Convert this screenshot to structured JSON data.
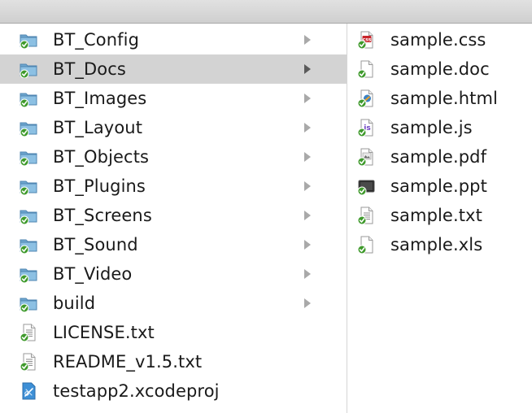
{
  "column1": {
    "items": [
      {
        "label": "BT_Config",
        "icon": "folder-icon",
        "kind": "folder",
        "selected": false
      },
      {
        "label": "BT_Docs",
        "icon": "folder-icon",
        "kind": "folder",
        "selected": true
      },
      {
        "label": "BT_Images",
        "icon": "folder-icon",
        "kind": "folder",
        "selected": false
      },
      {
        "label": "BT_Layout",
        "icon": "folder-icon",
        "kind": "folder",
        "selected": false
      },
      {
        "label": "BT_Objects",
        "icon": "folder-icon",
        "kind": "folder",
        "selected": false
      },
      {
        "label": "BT_Plugins",
        "icon": "folder-icon",
        "kind": "folder",
        "selected": false
      },
      {
        "label": "BT_Screens",
        "icon": "folder-icon",
        "kind": "folder",
        "selected": false
      },
      {
        "label": "BT_Sound",
        "icon": "folder-icon",
        "kind": "folder",
        "selected": false
      },
      {
        "label": "BT_Video",
        "icon": "folder-icon",
        "kind": "folder",
        "selected": false
      },
      {
        "label": "build",
        "icon": "folder-icon",
        "kind": "folder",
        "selected": false
      },
      {
        "label": "LICENSE.txt",
        "icon": "text-file-icon",
        "kind": "file",
        "selected": false
      },
      {
        "label": "README_v1.5.txt",
        "icon": "text-file-icon",
        "kind": "file",
        "selected": false
      },
      {
        "label": "testapp2.xcodeproj",
        "icon": "xcode-project-icon",
        "kind": "file",
        "selected": false
      }
    ]
  },
  "column2": {
    "items": [
      {
        "label": "sample.css",
        "icon": "css-file-icon"
      },
      {
        "label": "sample.doc",
        "icon": "blank-file-icon"
      },
      {
        "label": "sample.html",
        "icon": "html-file-icon"
      },
      {
        "label": "sample.js",
        "icon": "js-file-icon"
      },
      {
        "label": "sample.pdf",
        "icon": "pdf-file-icon"
      },
      {
        "label": "sample.ppt",
        "icon": "ppt-file-icon"
      },
      {
        "label": "sample.txt",
        "icon": "text-file-icon"
      },
      {
        "label": "sample.xls",
        "icon": "blank-file-icon"
      }
    ]
  },
  "colors": {
    "selection": "#d3d3d3",
    "folder": "#7fb3d8",
    "check_badge": "#3f9a2c",
    "chevron": "#a9a9a9"
  }
}
